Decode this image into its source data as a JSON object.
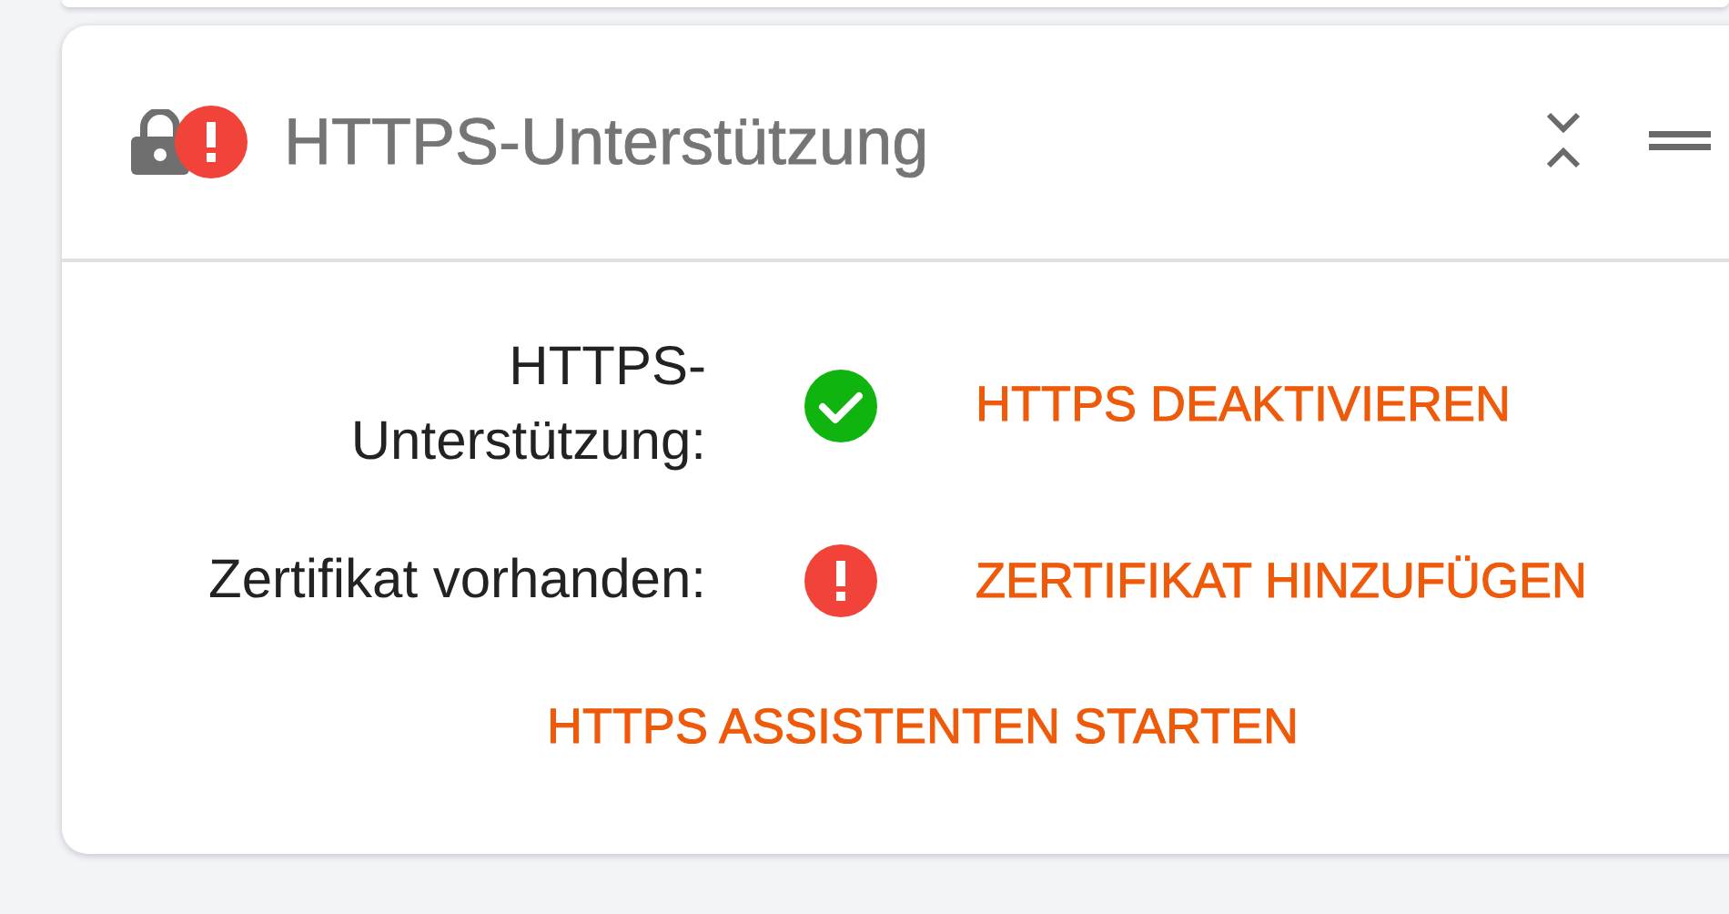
{
  "card": {
    "title": "HTTPS-Unterstützung",
    "warning": true,
    "rows": [
      {
        "label": "HTTPS-Unterstützung:",
        "ok": true,
        "action": "HTTPS DEAKTIVIEREN"
      },
      {
        "label": "Zertifikat vorhanden:",
        "ok": false,
        "action": "ZERTIFIKAT HINZUFÜGEN"
      }
    ],
    "footer_action": "HTTPS ASSISTENTEN STARTEN"
  }
}
